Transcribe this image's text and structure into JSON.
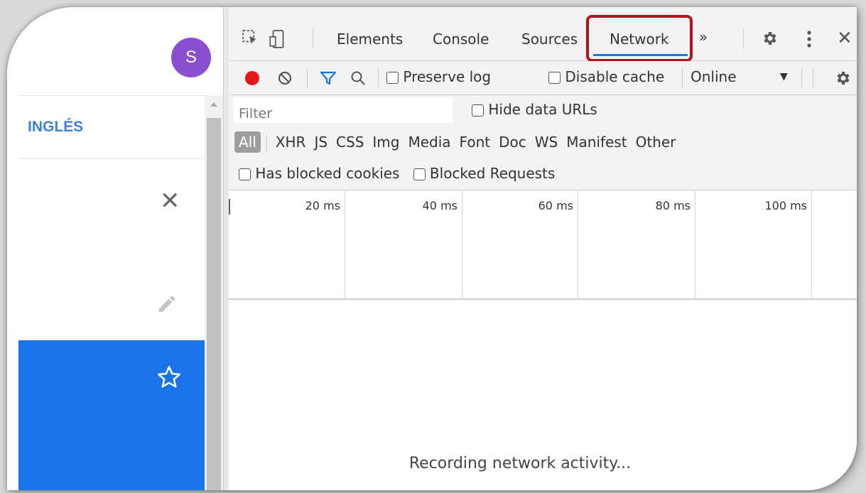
{
  "app": {
    "avatar_letter": "S",
    "avatar_color": "#8a4fd0",
    "language_label": "INGLÉS",
    "accent_color": "#1a73e8",
    "icons": [
      "close-icon",
      "pencil-icon",
      "star-icon"
    ]
  },
  "devtools": {
    "tabs": [
      "Elements",
      "Console",
      "Sources",
      "Network"
    ],
    "active_tab": "Network",
    "more_tabs": "»",
    "toolbar": {
      "preserve_log": "Preserve log",
      "disable_cache": "Disable cache",
      "throttling": "Online"
    },
    "filter": {
      "placeholder": "Filter",
      "hide_data_urls": "Hide data URLs",
      "types": [
        "All",
        "XHR",
        "JS",
        "CSS",
        "Img",
        "Media",
        "Font",
        "Doc",
        "WS",
        "Manifest",
        "Other"
      ],
      "has_blocked_cookies": "Has blocked cookies",
      "blocked_requests": "Blocked Requests"
    },
    "timeline": {
      "ticks": [
        "20 ms",
        "40 ms",
        "60 ms",
        "80 ms",
        "100 ms"
      ]
    },
    "empty_message": "Recording network activity..."
  }
}
